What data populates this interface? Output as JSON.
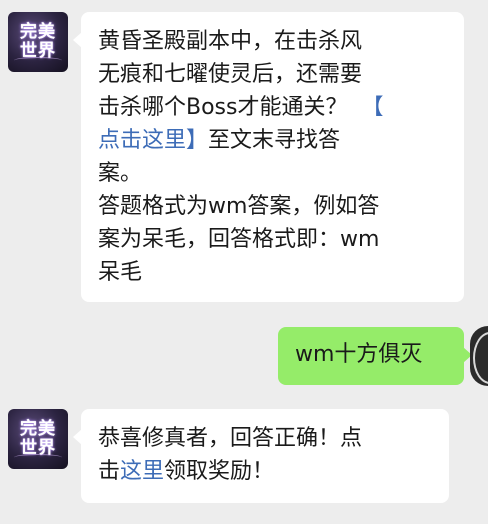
{
  "messages": [
    {
      "side": "left",
      "avatar_logo": [
        "完美",
        "世界"
      ],
      "lines": [
        "黄昏圣殿副本中，在击杀风",
        "无痕和七曜使灵后，还需要",
        "击杀哪个Boss才能通关？",
        "【",
        "点击这里】",
        "至文末寻找答",
        "案。",
        "答题格式为wm答案，例如答",
        "案为呆毛，回答格式即：wm",
        "呆毛"
      ]
    },
    {
      "side": "right",
      "text": "wm十方俱灭"
    },
    {
      "side": "left",
      "avatar_logo": [
        "完美",
        "世界"
      ],
      "line1": "恭喜修真者，回答正确！点",
      "line2_pre": "击",
      "line2_link": "这里",
      "line2_post": "领取奖励！"
    }
  ],
  "colors": {
    "background": "#ededed",
    "bubble_left": "#ffffff",
    "bubble_right": "#95ec69",
    "link": "#3d6cb7"
  }
}
